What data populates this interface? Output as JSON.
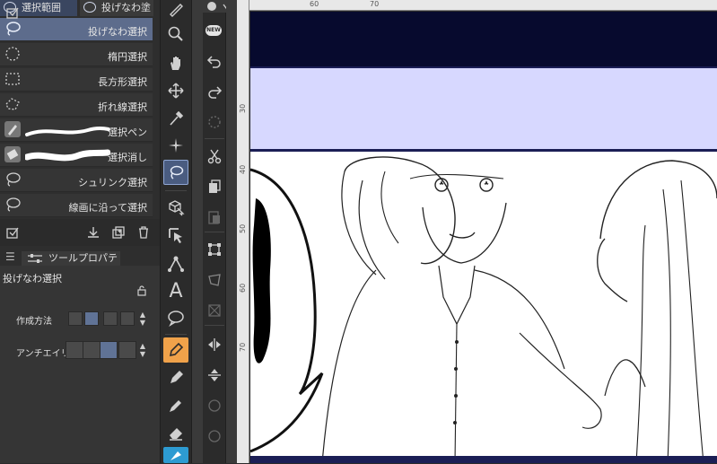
{
  "tool_panel": {
    "tabs": [
      {
        "label": "選択範囲",
        "active": true
      },
      {
        "label": "投げなわ塗",
        "active": false
      }
    ],
    "sub_tools": [
      {
        "label": "投げなわ選択",
        "icon": "lasso-icon",
        "selected": true
      },
      {
        "label": "楕円選択",
        "icon": "ellipse-select-icon",
        "selected": false
      },
      {
        "label": "長方形選択",
        "icon": "rectangle-select-icon",
        "selected": false
      },
      {
        "label": "折れ線選択",
        "icon": "polyline-select-icon",
        "selected": false
      },
      {
        "label": "選択ペン",
        "icon": "selection-pen-icon",
        "selected": false
      },
      {
        "label": "選択消し",
        "icon": "selection-eraser-icon",
        "selected": false
      },
      {
        "label": "シュリンク選択",
        "icon": "shrink-select-icon",
        "selected": false
      },
      {
        "label": "線画に沿って選択",
        "icon": "line-select-icon",
        "selected": false
      }
    ]
  },
  "property_panel": {
    "tab_label": "ツールプロパティ",
    "tool_name": "投げなわ選択",
    "creation_method_label": "作成方法",
    "antialias_label": "アンチエイリア"
  },
  "ruler": {
    "h_ticks": [
      "60",
      "70"
    ],
    "v_ticks": [
      "30",
      "40",
      "50",
      "60",
      "70"
    ]
  },
  "command_bar": {
    "new_badge": "NEW"
  },
  "colors": {
    "accent": "#5d6c8c",
    "active_tool": "#4a5c80",
    "pen_tool": "#f0a24a",
    "panel_dark": "#070a2e",
    "panel_lavender": "#d7d8ff"
  }
}
